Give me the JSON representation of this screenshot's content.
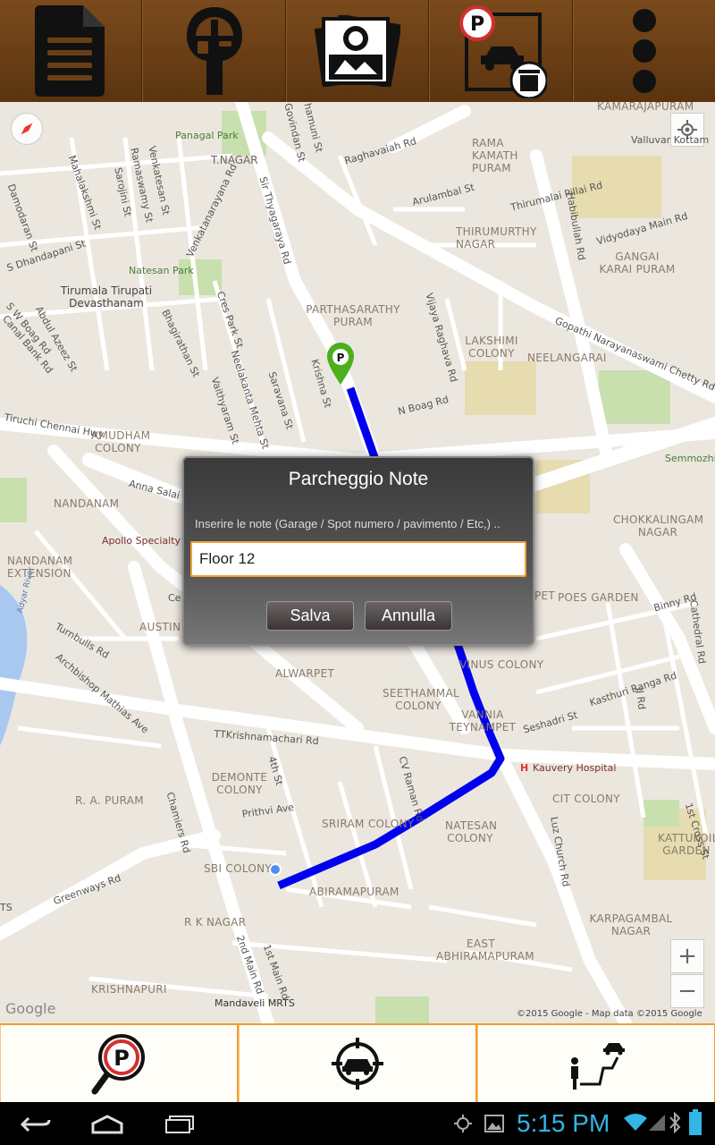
{
  "toolbar": {
    "icons": [
      "document-icon",
      "parking-meter-icon",
      "map-icon",
      "delete-parking-icon",
      "overflow-menu-icon"
    ]
  },
  "map": {
    "labels": {
      "kamarajapuram": "KAMARAJAPURAM",
      "valluvar_kottam": "Valluvar Kottam",
      "panagal_park": "Panagal Park",
      "raghavaiah_rd": "Raghavaiah Rd",
      "rama_kamath_puram": "RAMA KAMATH PURAM",
      "t_nagar": "T.NAGAR",
      "arulambal_st": "Arulambal St",
      "thirumalai_pillai_rd": "Thirumalai Pillai Rd",
      "vidyodaya_main_rd": "Vidyodaya Main Rd",
      "thirumurthy_nagar": "THIRUMURTHY NAGAR",
      "gangai_karai_puram": "GANGAI KARAI PURAM",
      "natesan_park": "Natesan Park",
      "tirumala_tirupati": "Tirumala Tirupati Devasthanam",
      "parthasarathy_puram": "PARTHASARATHY PURAM",
      "lakshimi_colony": "LAKSHIMI COLONY",
      "neelangarai": "NEELANGARAI",
      "gopathi_rd": "Gopathi Narayanaswami Chetty Rd",
      "n_boag_rd": "N Boag Rd",
      "tiruchi_chennai_hwy": "Tiruchi Chennai Hwy",
      "amudham_colony": "AMUDHAM COLONY",
      "anna_salai": "Anna Salai",
      "nandanam": "NANDANAM",
      "apollo": "Apollo Specialty H",
      "nandanam_ext": "NANDANAM EXTENSION",
      "chokkalingam_nagar": "CHOKKALINGAM NAGAR",
      "semmozhi": "Semmozhi",
      "poes_garden": "POES GARDEN",
      "binny_rd": "Binny Rd",
      "austin_n": "AUSTIN N",
      "alwarpet": "ALWARPET",
      "vinus_colony": "VINUS COLONY",
      "seethammal_colony": "SEETHAMMAL COLONY",
      "vannia_teynampet": "VANNIA TEYNAMPET",
      "seshadri_st": "Seshadri St",
      "kasthuri_ranga_rd": "Kasthuri Ranga Rd",
      "ttk_rd": "TTKrishnamachari Rd",
      "kauvery_hospital": "Kauvery Hospital",
      "demonte_colony": "DEMONTE COLONY",
      "r_a_puram": "R. A. PURAM",
      "cit_colony": "CIT COLONY",
      "sriram_colony": "SRIRAM COLONY",
      "natesan_colony": "NATESAN COLONY",
      "prithvi_ave": "Prithvi Ave",
      "kattukoil_garden": "KATTUKOIL GARDEN",
      "sbi_colony": "SBI COLONY",
      "abiramapuram": "ABIRAMAPURAM",
      "greenways_rd": "Greenways Rd",
      "r_k_nagar": "R K NAGAR",
      "karpagambal_nagar": "KARPAGAMBAL NAGAR",
      "east_abhiramapuram": "EAST ABHIRAMAPURAM",
      "krishnapuri": "KRISHNAPURI",
      "mandaveli_mrts": "Mandaveli MRTS",
      "archbishop": "Archbishop Mathias Ave",
      "turnbulls_rd": "Turnbulls Rd",
      "luz_church_rd": "Luz Church Rd",
      "first_main_rd": "1st Main Rd",
      "second_main_rd": "2nd Main Rd",
      "chamiers_rd": "Chamiers Rd",
      "cv_raman_rd": "CV Raman Rd",
      "krishna_st": "Krishna St",
      "vijaya_raghava_rd": "Vijaya Raghava Rd",
      "sir_thyagaraya_rd": "Sir Thyagaraya Rd",
      "fourth_st": "4th St",
      "habibullah_rd": "Habibullah Rd",
      "first_cross_st": "1st Cross St",
      "cathedral_rd": "Cathedral Rd",
      "jj_rd": "JJ Rd",
      "canal_bank_rd": "Canal Bank Rd",
      "sw_boag_rd": "S W Boag Rd",
      "abdul_azeez_st": "Abdul Azeez St",
      "s_dhandapani_st": "S Dhandapani St",
      "damodaran_st": "Damodaran St",
      "mahalakshmi_st": "Mahalakshmi St",
      "ramaswamy_st": "Ramaswamy St",
      "venkatesan_st": "Venkatesan St",
      "sarojini_st": "Sarojini St",
      "venkatanarayana_rd": "Venkatanarayana Rd",
      "bhagirathan_st": "Bhagirathan St",
      "cres_park_st": "Cres Park St",
      "neelakanta_mehta_st": "Neelakanta Mehta St",
      "vaithyaram_st": "Vaithyaram St",
      "saravana_st": "Saravana St",
      "govindan_st": "Govindan St",
      "hamumi_st": "hamuni St",
      "adyar_river": "Adyar River",
      "ts_fragment": "TS",
      "cenotaph_fragment": "Ce",
      "pet_fragment": "PET",
      "google_logo": "Google",
      "attribution": "©2015 Google - Map data ©2015 Google"
    },
    "zoom_in": "+",
    "zoom_out": "−",
    "colors": {
      "route": "#0000ee",
      "pin": "#4caf1d",
      "background": "#ebe7df"
    }
  },
  "dialog": {
    "title": "Parcheggio Note",
    "message": "Inserire le note (Garage / Spot numero / pavimento / Etc,) ..",
    "input_value": "Floor 12",
    "save_label": "Salva",
    "cancel_label": "Annulla",
    "accent_color": "#f2a13a"
  },
  "bottom_bar": {
    "icons": [
      "find-parking-icon",
      "locate-car-icon",
      "walk-route-icon"
    ]
  },
  "system": {
    "time": "5:15 PM"
  }
}
